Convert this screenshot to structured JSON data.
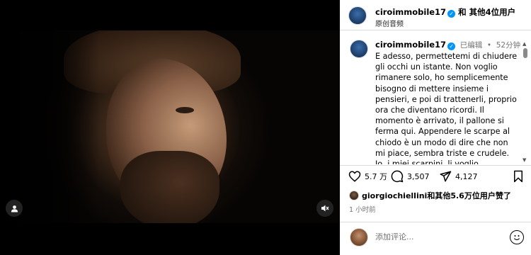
{
  "media": {
    "icons": {
      "user_tag": "user-icon",
      "mute": "speaker-mute-icon"
    }
  },
  "header": {
    "username": "ciroimmobile17",
    "and": "和",
    "others": "其他4位用户",
    "audio": "原创音频"
  },
  "caption": {
    "username": "ciroimmobile17",
    "edited": "已编辑",
    "separator": "•",
    "time_ago": "52分钟",
    "text": "E adesso, permettetemi di chiudere gli occhi un istante. Non voglio rimanere solo, ho semplicemente bisogno di mettere insieme i pensieri, e poi di trattenerli, proprio ora che diventano ricordi. Il momento è arrivato, il pallone si ferma qui. Appendere le scarpe al chiodo è un modo di dire che non mi piace, sembra triste e crudele. Io, i miei scarpini, li voglio appoggiare con"
  },
  "actions": {
    "likes": "5.7 万",
    "comments": "3,507",
    "shares": "4,127",
    "icons": {
      "like": "heart-icon",
      "comment": "comment-icon",
      "share": "share-icon",
      "save": "bookmark-icon"
    }
  },
  "liked_by": {
    "user": "giorgiochiellini",
    "rest": "和其他5.6万位用户赞了"
  },
  "posted": "1 小时前",
  "comment_box": {
    "placeholder": "添加评论..."
  },
  "colors": {
    "verified": "#0095f6",
    "border": "#dbdbdb",
    "muted": "#737373"
  }
}
